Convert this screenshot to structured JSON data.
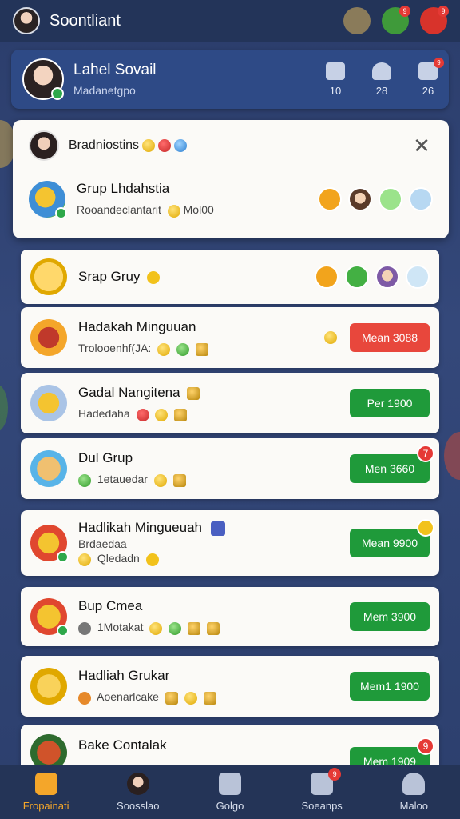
{
  "app": {
    "title": "Soontliant"
  },
  "topbar_icons": [
    {
      "name": "owl-icon",
      "badge": ""
    },
    {
      "name": "frog-icon",
      "badge": "9"
    },
    {
      "name": "gift-icon",
      "badge": "9"
    }
  ],
  "profile": {
    "name": "Lahel Sovail",
    "subtitle": "Madanetgpo",
    "stats": [
      {
        "icon": "house-icon",
        "value": "10",
        "badge": ""
      },
      {
        "icon": "person-icon",
        "value": "28",
        "badge": ""
      },
      {
        "icon": "person-plus-icon",
        "value": "26",
        "badge": "9"
      }
    ]
  },
  "panel": {
    "header": "Bradniostins",
    "group": {
      "name": "Grup Lhdahstia",
      "subtitle": "Rooandeclantarit",
      "subtitle2": "Mol00"
    }
  },
  "cards": [
    {
      "title": "Srap Gruy",
      "subtitle": "",
      "button": "",
      "button_color": ""
    },
    {
      "title": "Hadakah Minguuan",
      "subtitle": "Trolooenhf(JA:",
      "button": "Mean 3088",
      "button_color": "red"
    },
    {
      "title": "Gadal Nangitena",
      "subtitle": "Hadedaha",
      "button": "Per 1900",
      "button_color": "green"
    },
    {
      "title": "Dul Grup",
      "subtitle": "1etauedar",
      "button": "Men 3660",
      "button_color": "green",
      "badge": "7"
    },
    {
      "title": "Hadlikah Mingueuah",
      "subtitle": "Brdaedaa",
      "subtitle2": "Qledadn",
      "button": "Mean 9900",
      "button_color": "green",
      "badge_gold": true
    },
    {
      "title": "Bup Cmea",
      "subtitle": "1Motakat",
      "button": "Mem 3900",
      "button_color": "green"
    },
    {
      "title": "Hadliah Grukar",
      "subtitle": "Aoenarlcake",
      "button": "Mem1 1900",
      "button_color": "green"
    },
    {
      "title": "Bake Contalak",
      "subtitle": "",
      "button": "Mem 1909",
      "button_color": "green",
      "badge": "9"
    }
  ],
  "nav": [
    {
      "label": "Fropainati",
      "active": true
    },
    {
      "label": "Soosslao",
      "active": false
    },
    {
      "label": "Golgo",
      "active": false
    },
    {
      "label": "Soeanps",
      "active": false,
      "badge": "9"
    },
    {
      "label": "Maloo",
      "active": false
    }
  ]
}
